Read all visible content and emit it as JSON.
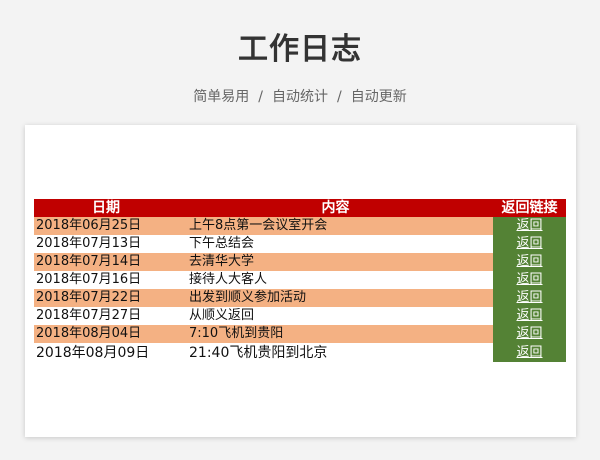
{
  "page": {
    "title": "工作日志",
    "subtitle": [
      "简单易用",
      "自动统计",
      "自动更新"
    ],
    "subtitle_separator": "/"
  },
  "table": {
    "headers": {
      "date": "日期",
      "content": "内容",
      "link": "返回链接"
    },
    "rows": [
      {
        "date": "2018年06月25日",
        "content": "上午8点第一会议室开会",
        "link": "返回"
      },
      {
        "date": "2018年07月13日",
        "content": "下午总结会",
        "link": "返回"
      },
      {
        "date": "2018年07月14日",
        "content": "去清华大学",
        "link": "返回"
      },
      {
        "date": "2018年07月16日",
        "content": "接待人大客人",
        "link": "返回"
      },
      {
        "date": "2018年07月22日",
        "content": "出发到顺义参加活动",
        "link": "返回"
      },
      {
        "date": "2018年07月27日",
        "content": "从顺义返回",
        "link": "返回"
      },
      {
        "date": "2018年08月04日",
        "content": "7:10飞机到贵阳",
        "link": "返回"
      },
      {
        "date": "2018年08月09日",
        "content": "21:40飞机贵阳到北京",
        "link": "返回"
      }
    ]
  },
  "colors": {
    "header_bg": "#c00000",
    "stripe_bg": "#f4b183",
    "link_bg": "#548235"
  }
}
